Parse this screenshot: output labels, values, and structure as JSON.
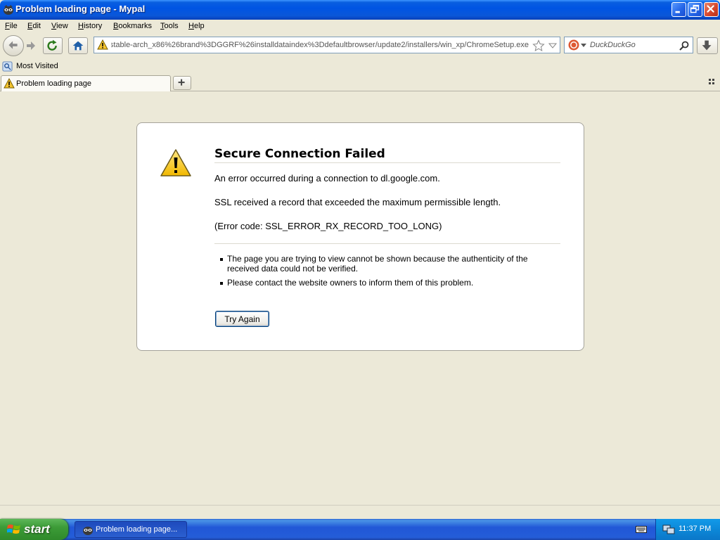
{
  "window": {
    "title": "Problem loading page - Mypal"
  },
  "menu": [
    "File",
    "Edit",
    "View",
    "History",
    "Bookmarks",
    "Tools",
    "Help"
  ],
  "navbar": {
    "url": "stable-arch_x86%26brand%3DGGRF%26installdataindex%3Ddefaultbrowser/update2/installers/win_xp/ChromeSetup.exe",
    "search_placeholder": "DuckDuckGo"
  },
  "bookmarks": {
    "most_visited": "Most Visited"
  },
  "tab": {
    "label": "Problem loading page"
  },
  "error": {
    "title": "Secure Connection Failed",
    "line1": "An error occurred during a connection to dl.google.com.",
    "line2": "SSL received a record that exceeded the maximum permissible length.",
    "code": "(Error code: SSL_ERROR_RX_RECORD_TOO_LONG)",
    "bullets": [
      "The page you are trying to view cannot be shown because the authenticity of the received data could not be verified.",
      "Please contact the website owners to inform them of this problem."
    ],
    "button": "Try Again"
  },
  "taskbar": {
    "start": "start",
    "task": "Problem loading page...",
    "clock": "11:37 PM"
  },
  "colors": {
    "titlebar": "#0054e3",
    "taskbar": "#245dd8",
    "start": "#3c9b37",
    "tray": "#0c88d8",
    "background": "#ece9d8"
  },
  "icons": [
    "mypal-icon",
    "minimize-icon",
    "restore-icon",
    "close-icon",
    "back-icon",
    "forward-icon",
    "reload-icon",
    "home-icon",
    "warning-icon",
    "star-icon",
    "dropdown-icon",
    "duckduckgo-icon",
    "search-icon",
    "download-icon",
    "bookmark-folder-icon",
    "new-tab-icon",
    "tab-list-icon",
    "windows-logo-icon",
    "keyboard-icon",
    "network-icon"
  ]
}
